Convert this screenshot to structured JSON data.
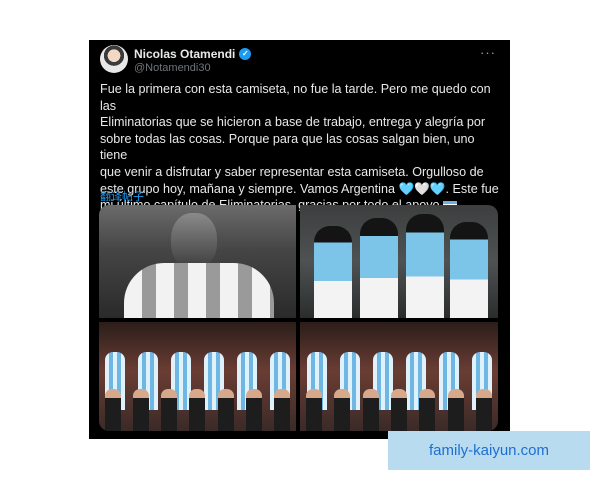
{
  "post": {
    "author_name": "Nicolas Otamendi",
    "handle": "@Notamendi30",
    "more_icon": "···",
    "verified_icon": "✓",
    "lines": [
      "Fue la primera con esta camiseta, no fue la tarde. Pero me quedo con las",
      "Eliminatorias que se hicieron a base de trabajo, entrega y alegría por",
      "sobre todas las cosas. Porque para que las cosas salgan bien, uno tiene",
      "que venir a disfrutar y saber representar esta camiseta. Orgulloso de",
      "este grupo hoy, mañana y siempre. Vamos Argentina",
      "mi último capítulo de Eliminatorias, gracias por todo el apoyo"
    ],
    "hearts": "🩵🤍🩵",
    "line5_suffix": ". Este fue",
    "translate_label": "翻译帖子"
  },
  "watermark": {
    "text": "family-kaiyun.com"
  },
  "colors": {
    "accent": "#1d9bf0",
    "card_bg": "#000000",
    "watermark_bg": "#b8dbef"
  }
}
